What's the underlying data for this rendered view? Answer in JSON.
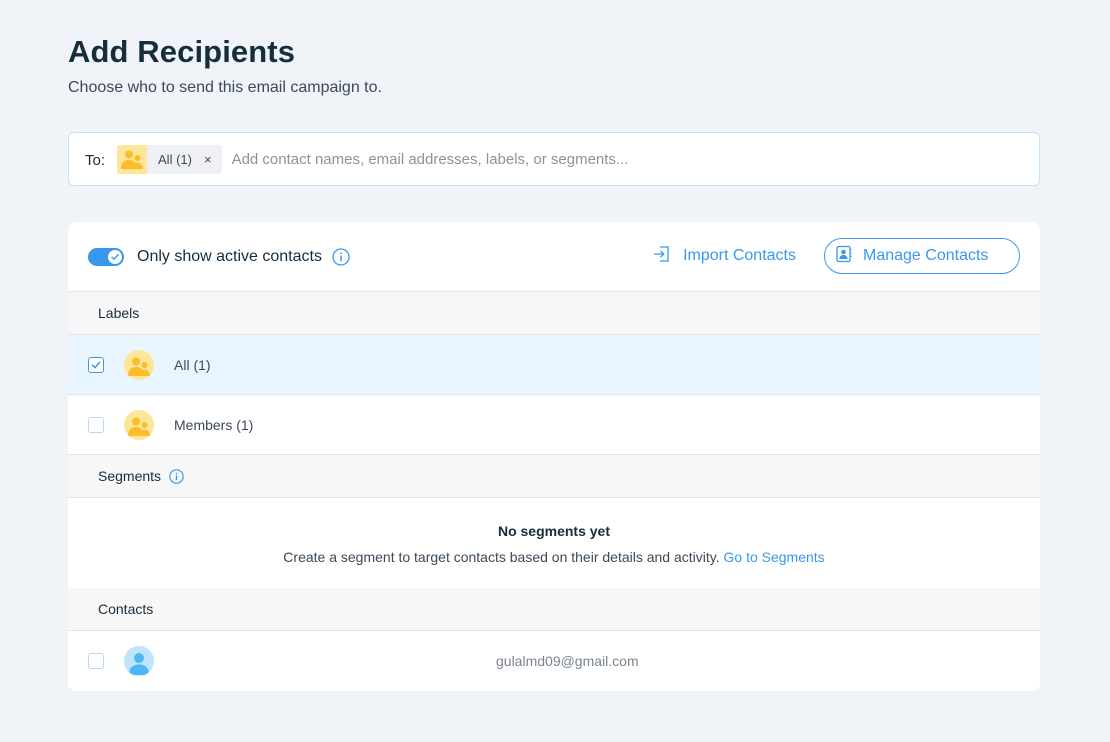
{
  "header": {
    "title": "Add Recipients",
    "subtitle": "Choose who to send this email campaign to."
  },
  "to_field": {
    "label": "To:",
    "chip_label": "All (1)",
    "chip_remove": "×",
    "placeholder": "Add contact names, email addresses, labels, or segments..."
  },
  "toolbar": {
    "toggle_label": "Only show active contacts",
    "toggle_on": true,
    "import_label": "Import Contacts",
    "manage_label": "Manage Contacts"
  },
  "sections": {
    "labels_title": "Labels",
    "labels": [
      {
        "label": "All (1)",
        "checked": true
      },
      {
        "label": "Members (1)",
        "checked": false
      }
    ],
    "segments_title": "Segments",
    "segments_empty_title": "No segments yet",
    "segments_empty_desc": "Create a segment to target contacts based on their details and activity.",
    "segments_link": "Go to Segments",
    "contacts_title": "Contacts",
    "contacts": [
      {
        "email": "gulalmd09@gmail.com",
        "checked": false
      }
    ]
  },
  "colors": {
    "accent": "#3899ec",
    "label_avatar": "#fde59a",
    "label_avatar_figure": "#fbbd2a",
    "contact_avatar": "#c1e4fe",
    "selected_row": "#eaf6ff",
    "background": "#f0f3f7"
  }
}
